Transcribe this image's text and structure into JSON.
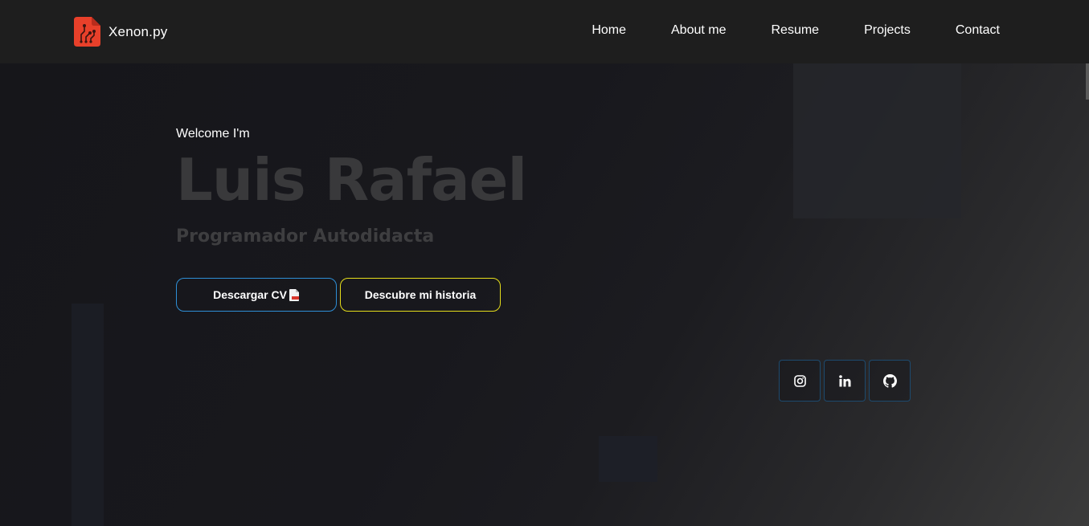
{
  "brand": {
    "name": "Xenon.py",
    "logo_icon": "circuit-file-icon",
    "accent": "#e8402a"
  },
  "nav": {
    "items": [
      {
        "label": "Home"
      },
      {
        "label": "About me"
      },
      {
        "label": "Resume"
      },
      {
        "label": "Projects"
      },
      {
        "label": "Contact"
      }
    ]
  },
  "hero": {
    "greeting": "Welcome I'm",
    "name": "Luis Rafael",
    "role": "Programador Autodidacta"
  },
  "buttons": {
    "download_cv": {
      "label": "Descargar CV",
      "icon": "pdf-file-icon",
      "border_color": "#2e8fd6"
    },
    "story": {
      "label": "Descubre mi historia",
      "border_color": "#e5dd1b"
    }
  },
  "socials": [
    {
      "icon": "instagram-icon"
    },
    {
      "icon": "linkedin-icon"
    },
    {
      "icon": "github-icon"
    }
  ]
}
